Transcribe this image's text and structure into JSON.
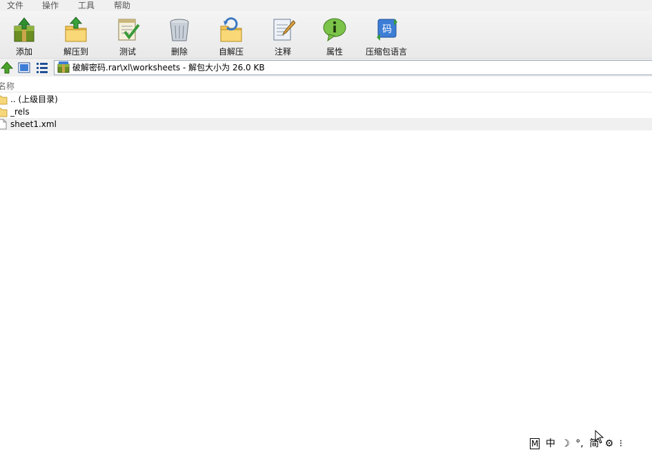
{
  "menu": {
    "items": [
      {
        "label": "文件",
        "name": "menu-file"
      },
      {
        "label": "操作",
        "name": "menu-operation"
      },
      {
        "label": "工具",
        "name": "menu-tools"
      },
      {
        "label": "帮助",
        "name": "menu-help"
      }
    ]
  },
  "toolbar": {
    "add": "添加",
    "extract_to": "解压到",
    "test": "测试",
    "delete": "删除",
    "sfx": "自解压",
    "comment": "注释",
    "properties": "属性",
    "archive_language": "压缩包语言",
    "lang_icon_glyph": "码"
  },
  "address": {
    "path": "破解密码.rar\\xl\\worksheets - 解包大小为 26.0 KB"
  },
  "columns": {
    "name": "名称"
  },
  "files": [
    {
      "name": ".. (上级目录)",
      "type": "folder"
    },
    {
      "name": "_rels",
      "type": "folder"
    },
    {
      "name": "sheet1.xml",
      "type": "file"
    }
  ],
  "ime": {
    "mode": "M",
    "lang": "中",
    "moon": "☽",
    "punct": "°,",
    "simplified": "简",
    "gear": "⚙",
    "more": "⁝"
  },
  "colors": {
    "menubar_bg": "#f0f0f0",
    "toolbar_bg": "#ececec",
    "selected_row": "#f0f0f0"
  }
}
